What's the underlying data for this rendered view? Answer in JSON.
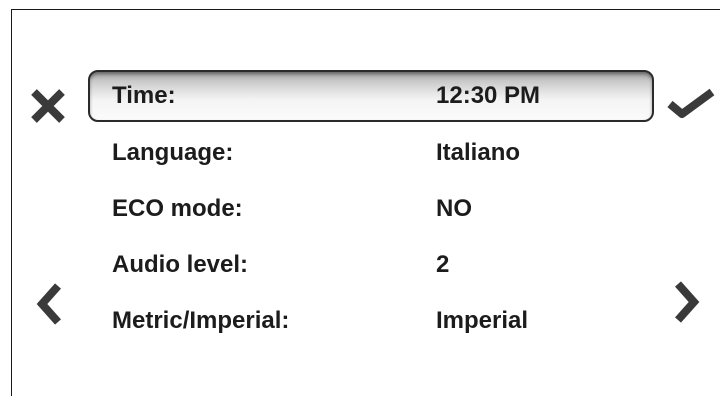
{
  "menu": {
    "items": [
      {
        "label": "Time:",
        "value": "12:30 PM",
        "selected": true
      },
      {
        "label": "Language:",
        "value": "Italiano",
        "selected": false
      },
      {
        "label": "ECO mode:",
        "value": "NO",
        "selected": false
      },
      {
        "label": "Audio level:",
        "value": "2",
        "selected": false
      },
      {
        "label": "Metric/Imperial:",
        "value": "Imperial",
        "selected": false
      }
    ]
  },
  "icons": {
    "cancel": "close-icon",
    "confirm": "checkmark-icon",
    "previous": "chevron-left-icon",
    "next": "chevron-right-icon"
  },
  "colors": {
    "text": "#1c1c1c",
    "icon": "#3a3a3a",
    "highlight_border": "#2b2b2b"
  }
}
